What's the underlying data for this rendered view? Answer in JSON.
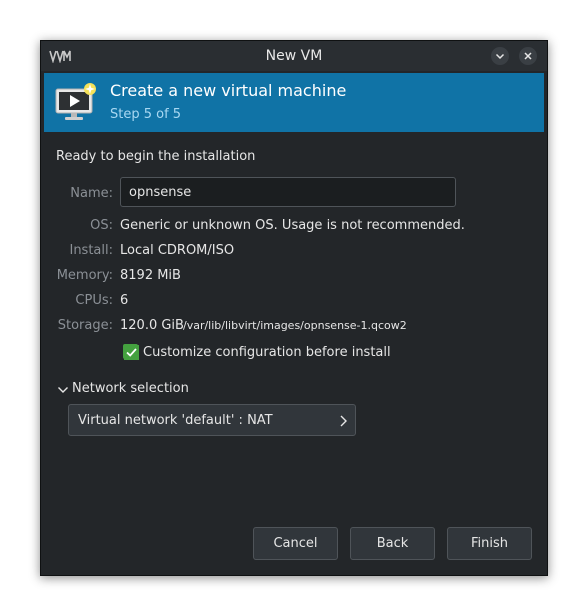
{
  "window": {
    "title": "New VM"
  },
  "header": {
    "title": "Create a new virtual machine",
    "subtitle": "Step 5 of 5"
  },
  "summary": {
    "ready_text": "Ready to begin the installation",
    "name_label": "Name:",
    "name_value": "opnsense",
    "os_label": "OS:",
    "os_value": "Generic or unknown OS. Usage is not recommended.",
    "install_label": "Install:",
    "install_value": "Local CDROM/ISO",
    "memory_label": "Memory:",
    "memory_value": "8192 MiB",
    "cpus_label": "CPUs:",
    "cpus_value": "6",
    "storage_label": "Storage:",
    "storage_size": "120.0 GiB",
    "storage_path": "/var/lib/libvirt/images/opnsense-1.qcow2"
  },
  "customize": {
    "label": "Customize configuration before install",
    "checked": true
  },
  "network": {
    "expander_label": "Network selection",
    "selected": "Virtual network 'default' : NAT"
  },
  "buttons": {
    "cancel": "Cancel",
    "back": "Back",
    "finish": "Finish"
  },
  "colors": {
    "header_bg": "#1073a6",
    "window_bg": "#232629",
    "check_accent": "#44a13f"
  },
  "icons": {
    "app": "virt-manager-icon",
    "header": "monitor-play-icon",
    "minimize": "chevron-down-icon",
    "close": "close-icon",
    "expander": "chevron-down-icon",
    "combo": "chevron-right-icon",
    "check": "checkmark-icon"
  }
}
